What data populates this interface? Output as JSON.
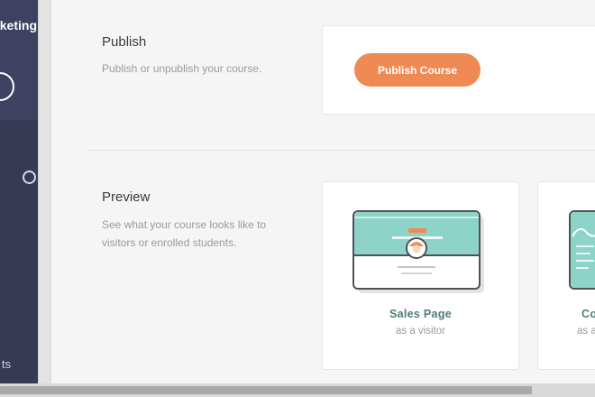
{
  "sidebar": {
    "brand_text": "keting",
    "bottom_label": "ts"
  },
  "publish": {
    "title": "Publish",
    "description": "Publish or unpublish your course.",
    "button_label": "Publish Course"
  },
  "preview": {
    "title": "Preview",
    "description_line1": "See what your course looks like to",
    "description_line2": "visitors or enrolled students.",
    "cards": [
      {
        "label": "Sales Page",
        "sublabel": "as a visitor"
      },
      {
        "label": "Co",
        "sublabel": "as a"
      }
    ]
  },
  "colors": {
    "sidebar": "#373a55",
    "accent": "#f08a54",
    "teal": "#8ed3c7",
    "link_text": "#4e7d78"
  },
  "icons": {
    "profile": "profile-ring-icon",
    "nav": "circle-indicator-icon",
    "sales_page": "sales-page-illustration-icon",
    "course_page": "course-page-illustration-icon"
  }
}
